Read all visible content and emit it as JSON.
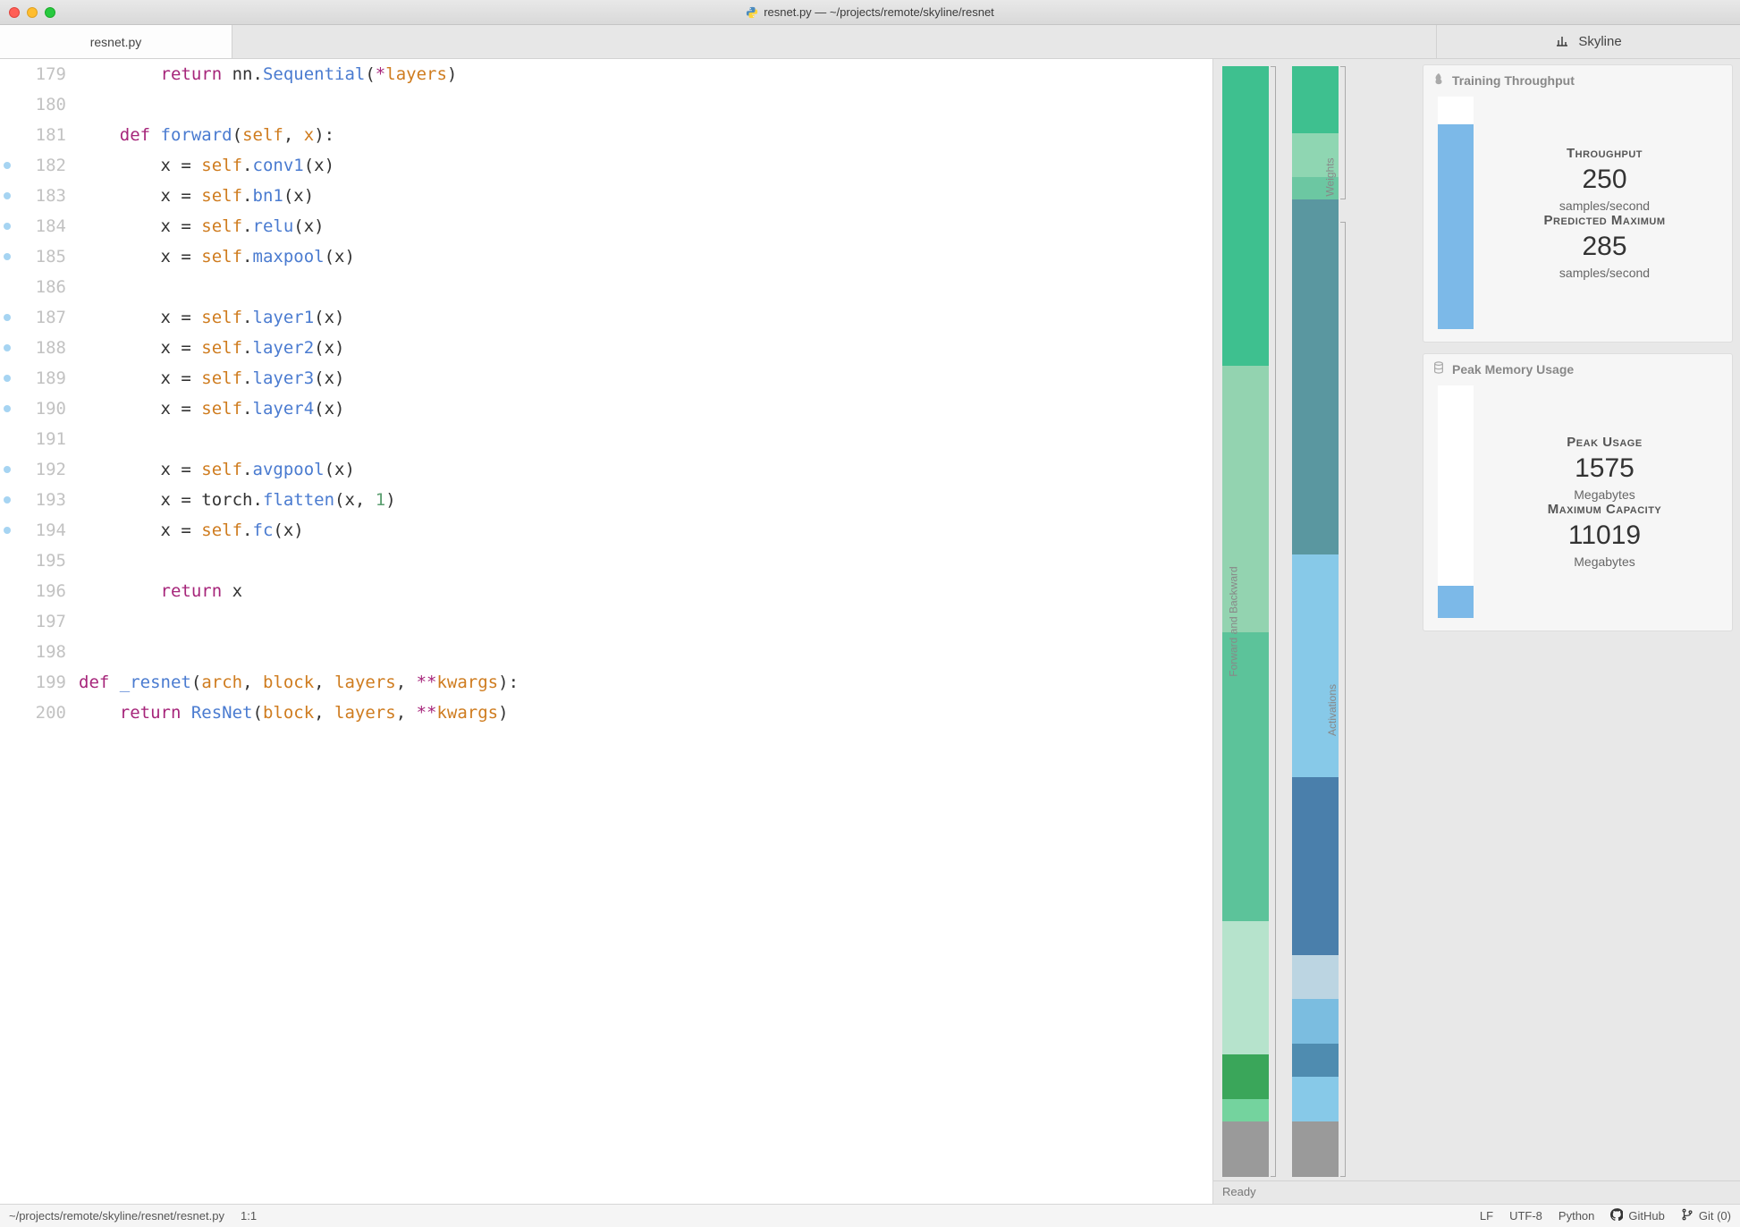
{
  "window": {
    "title": "resnet.py — ~/projects/remote/skyline/resnet"
  },
  "tabs": {
    "file_tab": "resnet.py",
    "panel_tab": "Skyline"
  },
  "editor": {
    "start_line": 179,
    "lines": [
      {
        "n": 179,
        "marker": false,
        "tokens": [
          [
            "        ",
            ""
          ],
          [
            "return",
            "kw"
          ],
          [
            " ",
            ""
          ],
          [
            "nn",
            "nm"
          ],
          [
            ".",
            ""
          ],
          [
            "Sequential",
            "fn"
          ],
          [
            "(",
            ""
          ],
          [
            "*",
            "op"
          ],
          [
            "layers",
            "arg"
          ],
          [
            ")",
            ""
          ]
        ]
      },
      {
        "n": 180,
        "marker": false,
        "tokens": [
          [
            "",
            ""
          ]
        ]
      },
      {
        "n": 181,
        "marker": false,
        "tokens": [
          [
            "    ",
            ""
          ],
          [
            "def",
            "kw"
          ],
          [
            " ",
            ""
          ],
          [
            "forward",
            "fn"
          ],
          [
            "(",
            ""
          ],
          [
            "self",
            "arg"
          ],
          [
            ", ",
            ""
          ],
          [
            "x",
            "arg"
          ],
          [
            "):",
            ""
          ]
        ]
      },
      {
        "n": 182,
        "marker": true,
        "tokens": [
          [
            "        x = ",
            ""
          ],
          [
            "self",
            "arg"
          ],
          [
            ".",
            ""
          ],
          [
            "conv1",
            "fn"
          ],
          [
            "(x)",
            ""
          ]
        ]
      },
      {
        "n": 183,
        "marker": true,
        "tokens": [
          [
            "        x = ",
            ""
          ],
          [
            "self",
            "arg"
          ],
          [
            ".",
            ""
          ],
          [
            "bn1",
            "fn"
          ],
          [
            "(x)",
            ""
          ]
        ]
      },
      {
        "n": 184,
        "marker": true,
        "tokens": [
          [
            "        x = ",
            ""
          ],
          [
            "self",
            "arg"
          ],
          [
            ".",
            ""
          ],
          [
            "relu",
            "fn"
          ],
          [
            "(x)",
            ""
          ]
        ]
      },
      {
        "n": 185,
        "marker": true,
        "tokens": [
          [
            "        x = ",
            ""
          ],
          [
            "self",
            "arg"
          ],
          [
            ".",
            ""
          ],
          [
            "maxpool",
            "fn"
          ],
          [
            "(x)",
            ""
          ]
        ]
      },
      {
        "n": 186,
        "marker": false,
        "tokens": [
          [
            "",
            ""
          ]
        ]
      },
      {
        "n": 187,
        "marker": true,
        "tokens": [
          [
            "        x = ",
            ""
          ],
          [
            "self",
            "arg"
          ],
          [
            ".",
            ""
          ],
          [
            "layer1",
            "fn"
          ],
          [
            "(x)",
            ""
          ]
        ]
      },
      {
        "n": 188,
        "marker": true,
        "tokens": [
          [
            "        x = ",
            ""
          ],
          [
            "self",
            "arg"
          ],
          [
            ".",
            ""
          ],
          [
            "layer2",
            "fn"
          ],
          [
            "(x)",
            ""
          ]
        ]
      },
      {
        "n": 189,
        "marker": true,
        "tokens": [
          [
            "        x = ",
            ""
          ],
          [
            "self",
            "arg"
          ],
          [
            ".",
            ""
          ],
          [
            "layer3",
            "fn"
          ],
          [
            "(x)",
            ""
          ]
        ]
      },
      {
        "n": 190,
        "marker": true,
        "tokens": [
          [
            "        x = ",
            ""
          ],
          [
            "self",
            "arg"
          ],
          [
            ".",
            ""
          ],
          [
            "layer4",
            "fn"
          ],
          [
            "(x)",
            ""
          ]
        ]
      },
      {
        "n": 191,
        "marker": false,
        "tokens": [
          [
            "",
            ""
          ]
        ]
      },
      {
        "n": 192,
        "marker": true,
        "tokens": [
          [
            "        x = ",
            ""
          ],
          [
            "self",
            "arg"
          ],
          [
            ".",
            ""
          ],
          [
            "avgpool",
            "fn"
          ],
          [
            "(x)",
            ""
          ]
        ]
      },
      {
        "n": 193,
        "marker": true,
        "tokens": [
          [
            "        x = ",
            ""
          ],
          [
            "torch",
            "nm"
          ],
          [
            ".",
            ""
          ],
          [
            "flatten",
            "fn"
          ],
          [
            "(x, ",
            ""
          ],
          [
            "1",
            "num"
          ],
          [
            ")",
            ""
          ]
        ]
      },
      {
        "n": 194,
        "marker": true,
        "tokens": [
          [
            "        x = ",
            ""
          ],
          [
            "self",
            "arg"
          ],
          [
            ".",
            ""
          ],
          [
            "fc",
            "fn"
          ],
          [
            "(x)",
            ""
          ]
        ]
      },
      {
        "n": 195,
        "marker": false,
        "tokens": [
          [
            "",
            ""
          ]
        ]
      },
      {
        "n": 196,
        "marker": false,
        "tokens": [
          [
            "        ",
            ""
          ],
          [
            "return",
            "kw"
          ],
          [
            " x",
            ""
          ]
        ]
      },
      {
        "n": 197,
        "marker": false,
        "tokens": [
          [
            "",
            ""
          ]
        ]
      },
      {
        "n": 198,
        "marker": false,
        "tokens": [
          [
            "",
            ""
          ]
        ]
      },
      {
        "n": 199,
        "marker": false,
        "tokens": [
          [
            "",
            ""
          ],
          [
            "def",
            "kw"
          ],
          [
            " ",
            ""
          ],
          [
            "_resnet",
            "fn"
          ],
          [
            "(",
            ""
          ],
          [
            "arch",
            "arg"
          ],
          [
            ", ",
            ""
          ],
          [
            "block",
            "arg"
          ],
          [
            ", ",
            ""
          ],
          [
            "layers",
            "arg"
          ],
          [
            ", ",
            ""
          ],
          [
            "**",
            "op"
          ],
          [
            "kwargs",
            "arg"
          ],
          [
            "):",
            ""
          ]
        ]
      },
      {
        "n": 200,
        "marker": false,
        "tokens": [
          [
            "    ",
            ""
          ],
          [
            "return",
            "kw"
          ],
          [
            " ",
            ""
          ],
          [
            "ResNet",
            "fn"
          ],
          [
            "(",
            ""
          ],
          [
            "block",
            "arg"
          ],
          [
            ", ",
            ""
          ],
          [
            "layers",
            "arg"
          ],
          [
            ", ",
            ""
          ],
          [
            "**",
            "op"
          ],
          [
            "kwargs",
            "arg"
          ],
          [
            ")",
            ""
          ]
        ]
      }
    ]
  },
  "skyline": {
    "bars": {
      "fwd_label": "Forward and Backward",
      "weights_label": "Weights",
      "activations_label": "Activations",
      "column1": [
        {
          "h": 27,
          "c": "#3ec08f"
        },
        {
          "h": 24,
          "c": "#93d3b0"
        },
        {
          "h": 26,
          "c": "#5cc39a"
        },
        {
          "h": 12,
          "c": "#b6e3cc"
        },
        {
          "h": 4,
          "c": "#3aa65a"
        },
        {
          "h": 2,
          "c": "#74d39e"
        },
        {
          "h": 5,
          "c": "#9a9a9a"
        }
      ],
      "column2": [
        {
          "h": 6,
          "c": "#3ec08f"
        },
        {
          "h": 4,
          "c": "#8fd6b2"
        },
        {
          "h": 2,
          "c": "#6cc7a2"
        },
        {
          "h": 32,
          "c": "#5a97a0"
        },
        {
          "h": 20,
          "c": "#87c9e8"
        },
        {
          "h": 16,
          "c": "#4a7fab"
        },
        {
          "h": 4,
          "c": "#bcd5e2"
        },
        {
          "h": 4,
          "c": "#7bbde0"
        },
        {
          "h": 3,
          "c": "#4f8cb0"
        },
        {
          "h": 4,
          "c": "#87c9e8"
        },
        {
          "h": 5,
          "c": "#9a9a9a"
        }
      ]
    },
    "cards": {
      "throughput": {
        "header": "Training Throughput",
        "fill_pct": 88,
        "metrics": [
          {
            "label": "Throughput",
            "val": "250",
            "unit": "samples/second"
          },
          {
            "label": "Predicted Maximum",
            "val": "285",
            "unit": "samples/second"
          }
        ]
      },
      "memory": {
        "header": "Peak Memory Usage",
        "fill_pct": 14,
        "metrics": [
          {
            "label": "Peak Usage",
            "val": "1575",
            "unit": "Megabytes"
          },
          {
            "label": "Maximum Capacity",
            "val": "11019",
            "unit": "Megabytes"
          }
        ]
      }
    },
    "status": "Ready"
  },
  "statusbar": {
    "path": "~/projects/remote/skyline/resnet/resnet.py",
    "cursor": "1:1",
    "eol": "LF",
    "encoding": "UTF-8",
    "language": "Python",
    "github": "GitHub",
    "git": "Git (0)"
  },
  "chart_data": [
    {
      "type": "bar",
      "title": "Training Throughput",
      "categories": [
        "Throughput",
        "Predicted Maximum"
      ],
      "values": [
        250,
        285
      ],
      "ylabel": "samples/second",
      "ylim": [
        0,
        285
      ]
    },
    {
      "type": "bar",
      "title": "Peak Memory Usage",
      "categories": [
        "Peak Usage",
        "Maximum Capacity"
      ],
      "values": [
        1575,
        11019
      ],
      "ylabel": "Megabytes",
      "ylim": [
        0,
        11019
      ]
    }
  ]
}
